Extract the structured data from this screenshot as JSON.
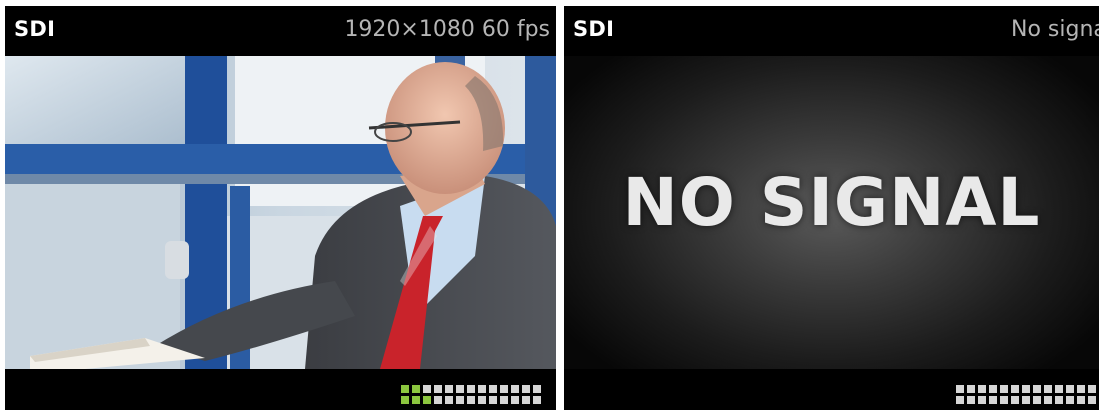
{
  "panels": [
    {
      "source": "SDI",
      "status": "1920×1080 60 fps",
      "audio_meter": {
        "active_cells_bottom_row": 3,
        "active_cells_top_row": 2,
        "columns": 13
      }
    },
    {
      "source": "SDI",
      "status": "No signal",
      "message": "NO SIGNAL",
      "audio_meter": {
        "active_cells_bottom_row": 0,
        "active_cells_top_row": 0,
        "columns": 13
      }
    }
  ],
  "colors": {
    "meter_active": "#8cc63f",
    "meter_idle": "#d6d6d6",
    "header_bg": "#000000",
    "status_text": "#b5b5b5"
  },
  "icons": [
    "camera-video-frame",
    "audio-level-meter"
  ]
}
